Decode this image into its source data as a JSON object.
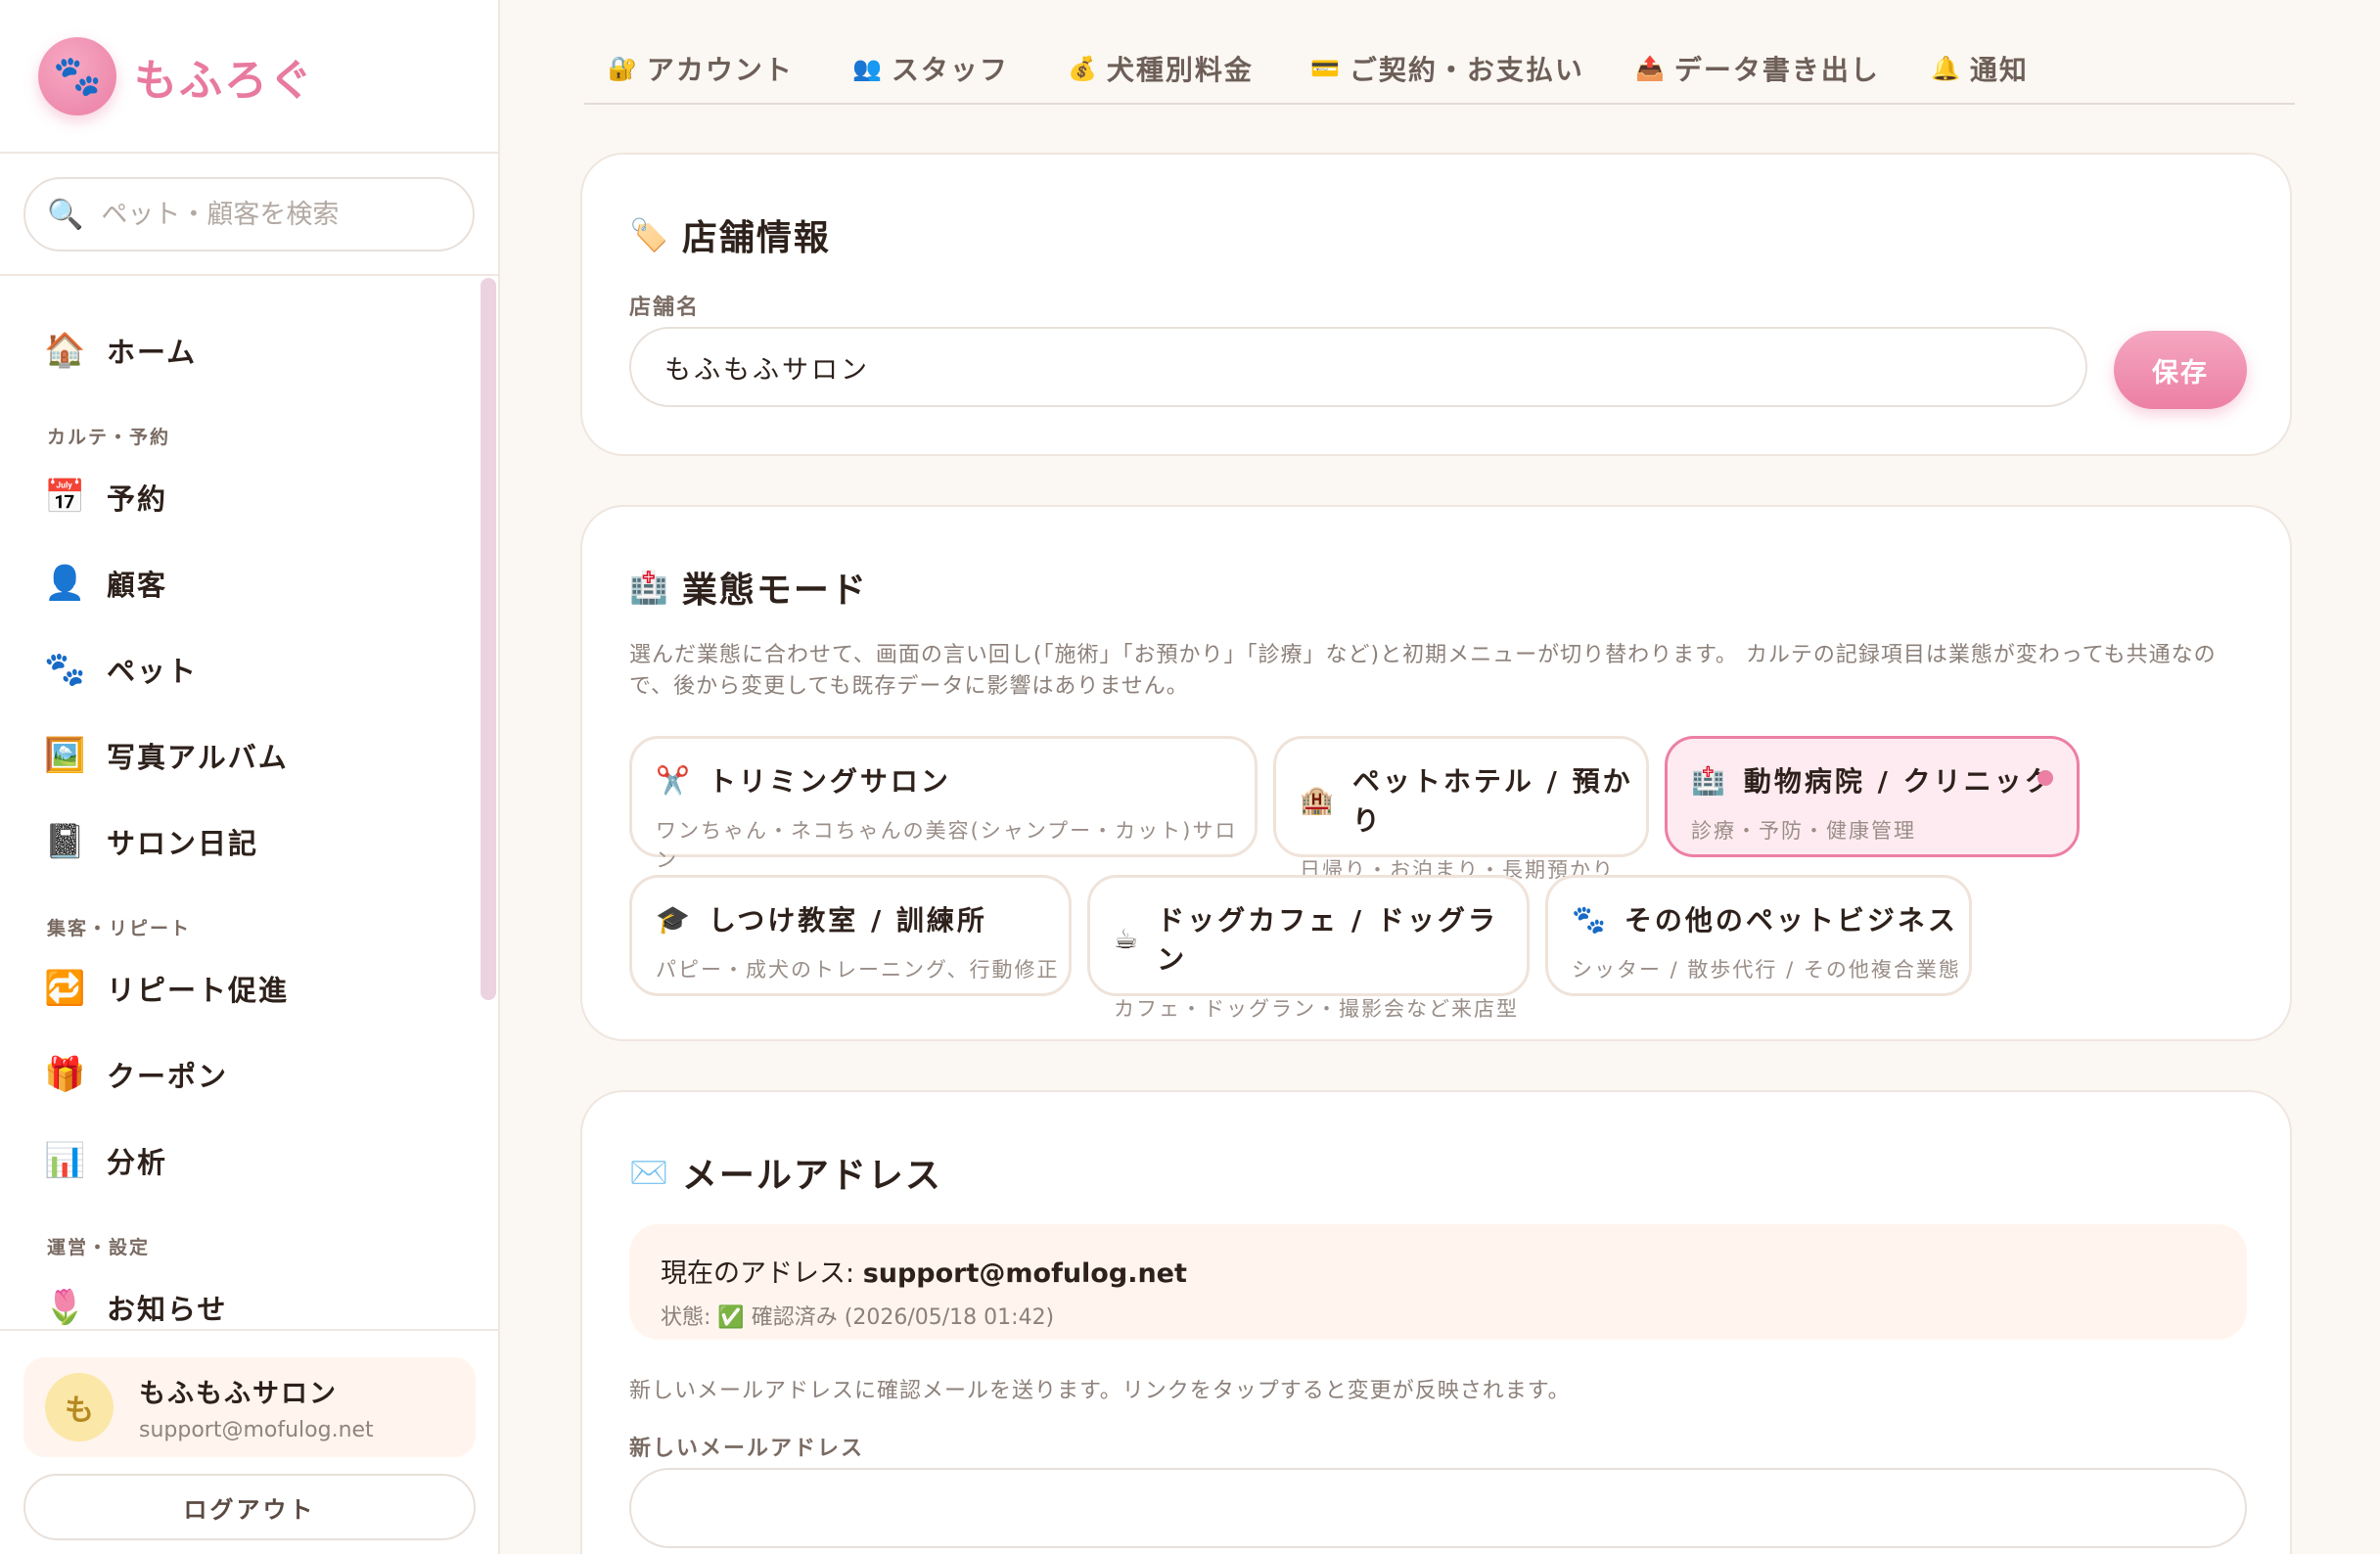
{
  "brand": {
    "name": "もふろぐ",
    "logo_icon": "paw-icon"
  },
  "search": {
    "placeholder": "ペット・顧客を検索"
  },
  "nav": {
    "home": "ホーム",
    "section_karte": "カルテ・予約",
    "reservation": "予約",
    "customer": "顧客",
    "pet": "ペット",
    "album": "写真アルバム",
    "diary": "サロン日記",
    "section_marketing": "集客・リピート",
    "repeat": "リピート促進",
    "coupon": "クーポン",
    "analytics": "分析",
    "section_settings": "運営・設定",
    "notice": "お知らせ"
  },
  "user": {
    "avatar_initial": "も",
    "name": "もふもふサロン",
    "email": "support@mofulog.net",
    "logout": "ログアウト"
  },
  "tabs": [
    {
      "label": "アカウント",
      "icon": "lock-icon"
    },
    {
      "label": "スタッフ",
      "icon": "people-icon"
    },
    {
      "label": "犬種別料金",
      "icon": "moneybag-icon"
    },
    {
      "label": "ご契約・お支払い",
      "icon": "credit-card-icon"
    },
    {
      "label": "データ書き出し",
      "icon": "outbox-icon"
    },
    {
      "label": "通知",
      "icon": "bell-icon"
    }
  ],
  "store": {
    "title": "店舗情報",
    "field_label": "店舗名",
    "name_value": "もふもふサロン",
    "save": "保存"
  },
  "business_mode": {
    "title": "業態モード",
    "description": "選んだ業態に合わせて、画面の言い回し(「施術」「お預かり」「診療」など)と初期メニューが切り替わります。 カルテの記録項目は業態が変わっても共通なので、後から変更しても既存データに影響はありません。",
    "selected": "動物病院 / クリニック",
    "modes": [
      {
        "name": "トリミングサロン",
        "sub": "ワンちゃん・ネコちゃんの美容(シャンプー・カット)サロン",
        "icon": "scissors-icon"
      },
      {
        "name": "ペットホテル / 預かり",
        "sub": "日帰り・お泊まり・長期預かり",
        "icon": "hotel-icon"
      },
      {
        "name": "動物病院 / クリニック",
        "sub": "診療・予防・健康管理",
        "icon": "hospital-icon"
      },
      {
        "name": "しつけ教室 / 訓練所",
        "sub": "パピー・成犬のトレーニング、行動修正",
        "icon": "graduation-cap-icon"
      },
      {
        "name": "ドッグカフェ / ドッグラン",
        "sub": "カフェ・ドッグラン・撮影会など来店型",
        "icon": "coffee-icon"
      },
      {
        "name": "その他のペットビジネス",
        "sub": "シッター / 散歩代行 / その他複合業態",
        "icon": "paw-icon"
      }
    ]
  },
  "email": {
    "title": "メールアドレス",
    "current_label": "現在のアドレス: ",
    "current_value": "support@mofulog.net",
    "status": "状態: ✅ 確認済み (2026/05/18 01:42)",
    "help": "新しいメールアドレスに確認メールを送ります。リンクをタップすると変更が反映されます。",
    "new_label": "新しいメールアドレス",
    "new_value": ""
  },
  "colors": {
    "accent": "#ec7fa4",
    "background": "#fbf7f2",
    "card": "#ffffff"
  }
}
